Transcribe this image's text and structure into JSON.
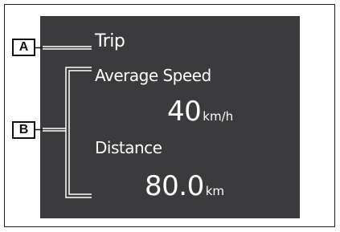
{
  "callouts": {
    "a": "A",
    "b": "B"
  },
  "display": {
    "trip_label": "Trip",
    "average_speed_label": "Average Speed",
    "average_speed_value": "40",
    "average_speed_unit": "km/h",
    "distance_label": "Distance",
    "distance_value": "80.0",
    "distance_unit": "km"
  },
  "colors": {
    "screen_background": "#3b3b3d",
    "text": "#ffffff",
    "frame": "#1a1a1a"
  }
}
